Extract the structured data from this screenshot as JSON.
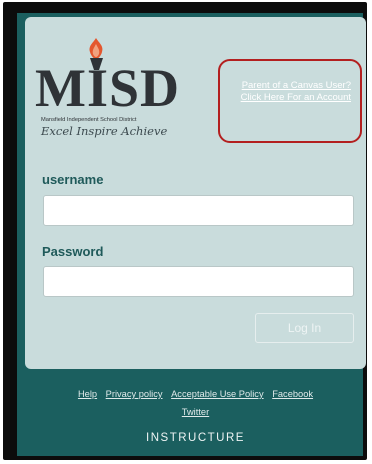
{
  "logo": {
    "abbreviation": "MISD",
    "district_name": "Mansfield Independent School District",
    "tagline": "Excel  Inspire  Achieve"
  },
  "parent_link": {
    "line1": "Parent of a Canvas User?",
    "line2": "Click Here For an Account"
  },
  "form": {
    "username_label": "username",
    "password_label": "Password",
    "username_value": "",
    "password_value": "",
    "login_label": "Log In"
  },
  "footer": {
    "links": [
      "Help",
      "Privacy policy",
      "Acceptable Use Policy",
      "Facebook",
      "Twitter"
    ],
    "brand": "INSTRUCTURE"
  },
  "colors": {
    "background": "#1b5f5f",
    "card": "#c9dcdc",
    "highlight_border": "#b31f1f",
    "logo_text": "#2f3337",
    "flame": "#e4572e"
  },
  "icons": {
    "logo_mark": "torch-flame-icon"
  }
}
